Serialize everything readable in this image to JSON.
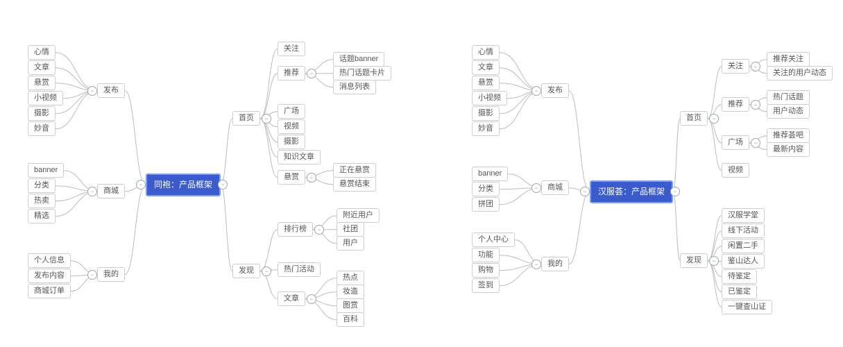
{
  "map1": {
    "root": "同袍：产品框架",
    "left": {
      "publish": {
        "label": "发布",
        "items": [
          "心情",
          "文章",
          "悬赏",
          "小视频",
          "摄影",
          "妙音"
        ]
      },
      "mall": {
        "label": "商城",
        "items": [
          "banner",
          "分类",
          "热卖",
          "精选"
        ]
      },
      "mine": {
        "label": "我的",
        "items": [
          "个人信息",
          "发布内容",
          "商城订单"
        ]
      }
    },
    "right": {
      "home": {
        "label": "首页",
        "children": {
          "follow": {
            "label": "关注"
          },
          "recommend": {
            "label": "推荐",
            "items": [
              "话题banner",
              "热门话题卡片",
              "消息列表"
            ]
          },
          "square": {
            "label": "广场"
          },
          "video": {
            "label": "视频"
          },
          "photo": {
            "label": "摄影"
          },
          "know": {
            "label": "知识文章"
          },
          "bounty": {
            "label": "悬赏",
            "items": [
              "正在悬赏",
              "悬赏结束"
            ]
          }
        }
      },
      "discover": {
        "label": "发现",
        "children": {
          "rank": {
            "label": "排行榜",
            "items": [
              "附近用户",
              "社团",
              "用户"
            ]
          },
          "hot": {
            "label": "热门活动"
          },
          "article": {
            "label": "文章",
            "items": [
              "热点",
              "妆造",
              "图赏",
              "百科"
            ]
          }
        }
      }
    }
  },
  "map2": {
    "root": "汉服荟：产品框架",
    "left": {
      "publish": {
        "label": "发布",
        "items": [
          "心情",
          "文章",
          "悬赏",
          "小视频",
          "摄影",
          "妙音"
        ]
      },
      "mall": {
        "label": "商城",
        "items": [
          "banner",
          "分类",
          "拼团"
        ]
      },
      "mine": {
        "label": "我的",
        "items": [
          "个人中心",
          "功能",
          "购物",
          "签到"
        ]
      }
    },
    "right": {
      "home": {
        "label": "首页",
        "children": {
          "follow": {
            "label": "关注",
            "items": [
              "推荐关注",
              "关注的用户动态"
            ]
          },
          "recommend": {
            "label": "推荐",
            "items": [
              "热门话题",
              "用户动态"
            ]
          },
          "square": {
            "label": "广场",
            "items": [
              "推荐荟吧",
              "最新内容"
            ]
          },
          "video": {
            "label": "视频"
          }
        }
      },
      "discover": {
        "label": "发现",
        "items": [
          "汉服学堂",
          "线下活动",
          "闲置二手",
          "鉴山达人",
          "待鉴定",
          "已鉴定",
          "一键查山证"
        ]
      }
    }
  },
  "toggle": "−"
}
